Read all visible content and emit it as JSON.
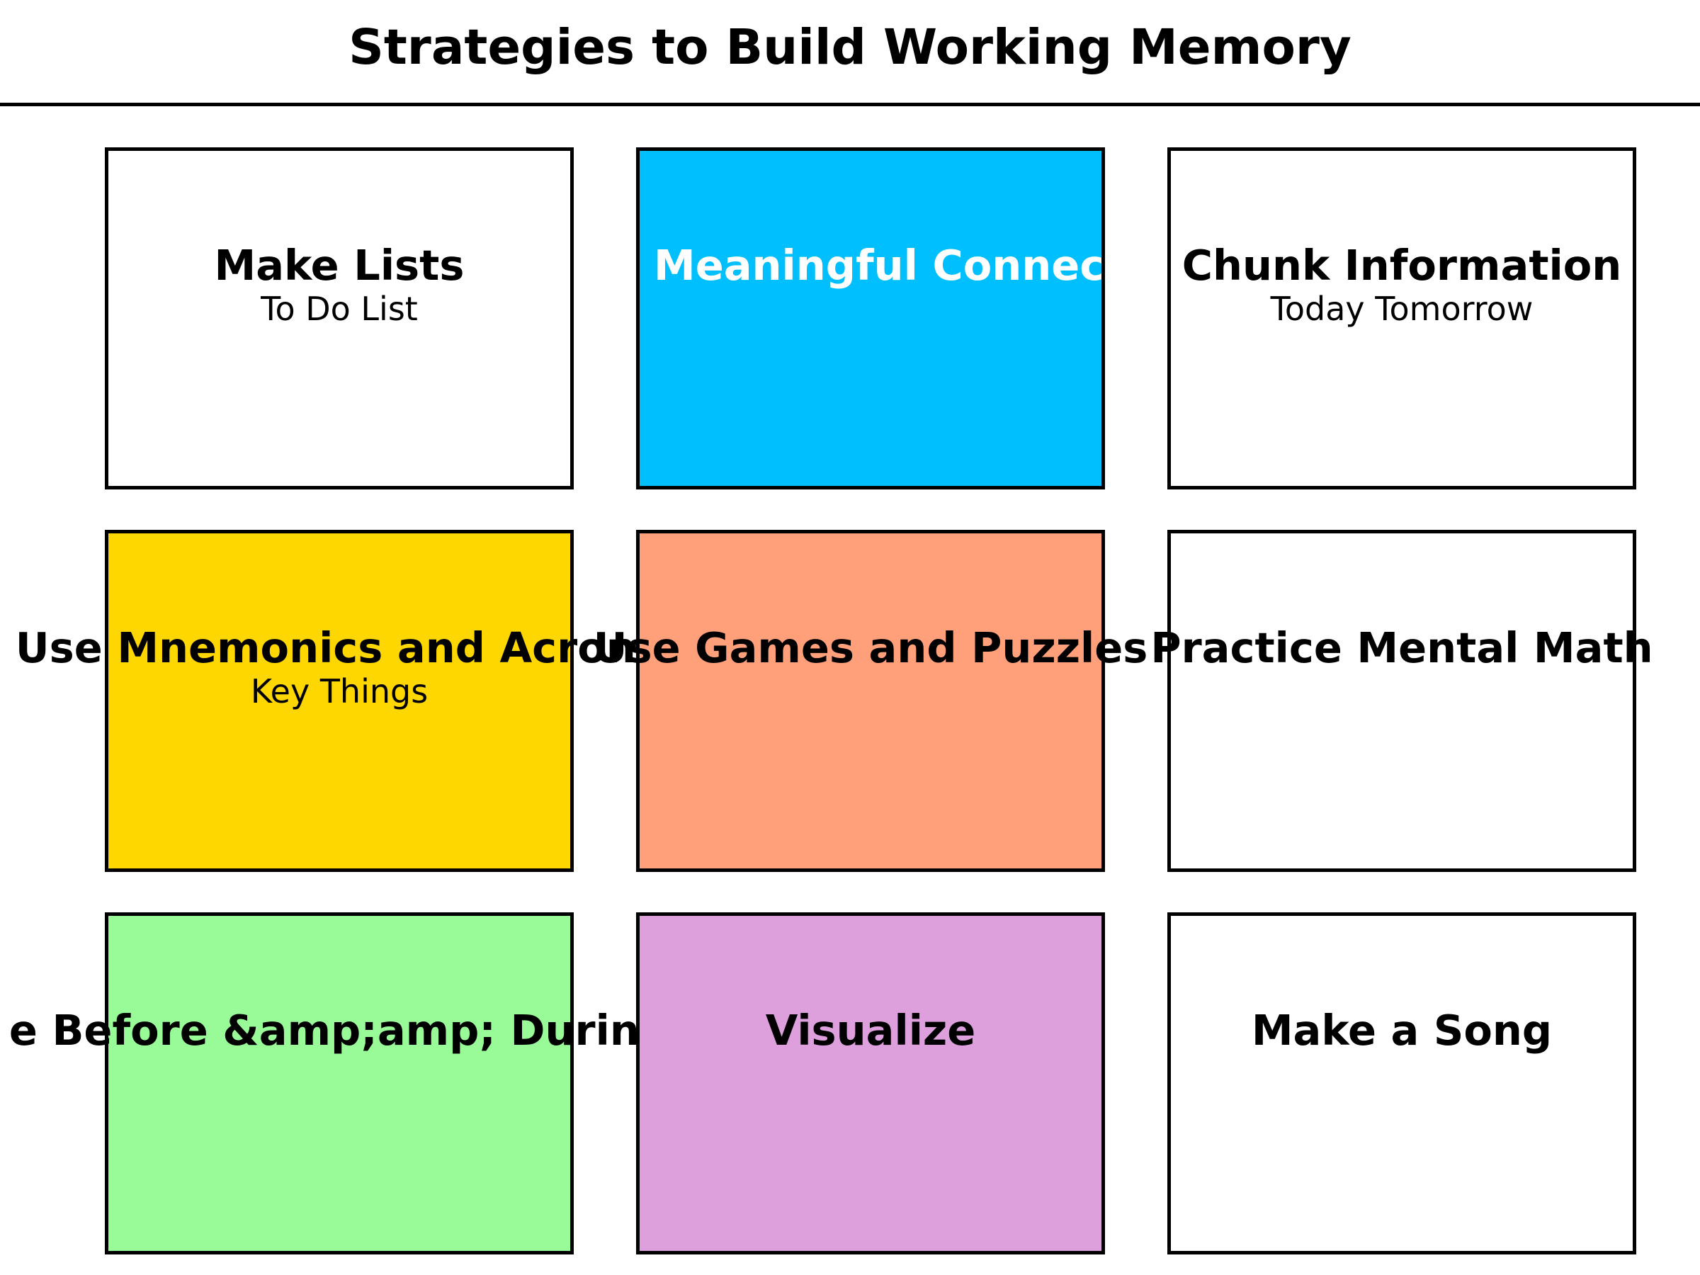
{
  "title": "Strategies to Build Working Memory",
  "cards": [
    {
      "title": "Make Lists",
      "subtitle": "To Do List",
      "bg": "#ffffff",
      "text_color": "#000000"
    },
    {
      "title": "Meaningful Connec",
      "subtitle": "",
      "bg": "#00bfff",
      "text_color": "#ffffff"
    },
    {
      "title": "Chunk Information",
      "subtitle": "Today Tomorrow",
      "bg": "#ffffff",
      "text_color": "#000000"
    },
    {
      "title": "Use Mnemonics and Acrony",
      "subtitle": "Key Things",
      "bg": "#ffd700",
      "text_color": "#000000"
    },
    {
      "title": "Use Games and Puzzles",
      "subtitle": "",
      "bg": "#ffa07a",
      "text_color": "#000000"
    },
    {
      "title": "Practice Mental Math",
      "subtitle": "",
      "bg": "#ffffff",
      "text_color": "#000000"
    },
    {
      "title": "e Before &amp;amp; During",
      "subtitle": "",
      "bg": "#98fb98",
      "text_color": "#000000"
    },
    {
      "title": "Visualize",
      "subtitle": "",
      "bg": "#dda0dd",
      "text_color": "#000000"
    },
    {
      "title": "Make a Song",
      "subtitle": "",
      "bg": "#ffffff",
      "text_color": "#000000"
    }
  ]
}
